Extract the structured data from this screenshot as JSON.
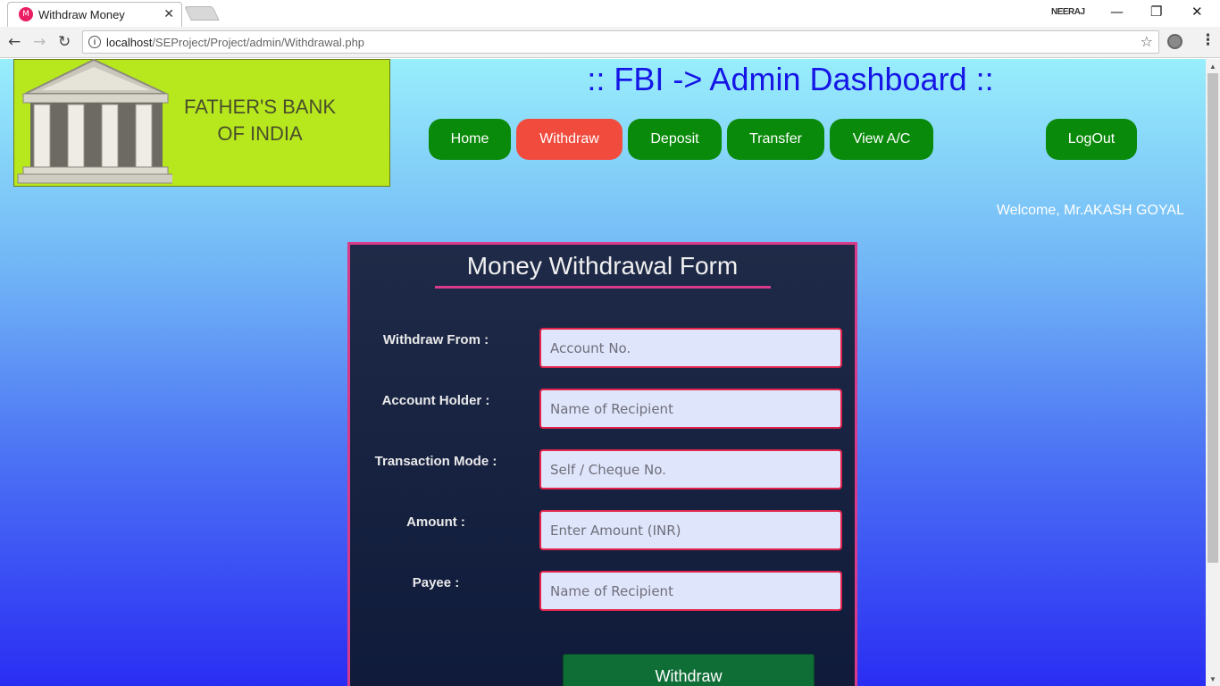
{
  "browser": {
    "tab_title": "Withdraw Money",
    "tab_close": "✕",
    "user": "NEERAJ",
    "url_host": "localhost",
    "url_path": "/SEProject/Project/admin/Withdrawal.php",
    "win_minimize": "—",
    "win_restore": "❐",
    "win_close": "✕",
    "back": "←",
    "forward": "→",
    "reload": "↻",
    "star": "☆",
    "menu": "⋮",
    "info": "i"
  },
  "logo": {
    "line1": "FATHER'S BANK",
    "line2": "OF INDIA"
  },
  "header": {
    "title": ":: FBI -> Admin Dashboard ::"
  },
  "nav": {
    "home": "Home",
    "withdraw": "Withdraw",
    "deposit": "Deposit",
    "transfer": "Transfer",
    "view_ac": "View A/C",
    "logout": "LogOut",
    "active_color": "#f14b3e",
    "button_color": "#0a8a0a"
  },
  "welcome": "Welcome, Mr.AKASH GOYAL",
  "form": {
    "title": "Money Withdrawal Form",
    "fields": [
      {
        "label": "Withdraw From :",
        "placeholder": "Account No."
      },
      {
        "label": "Account Holder :",
        "placeholder": "Name of Recipient"
      },
      {
        "label": "Transaction Mode :",
        "placeholder": "Self / Cheque No."
      },
      {
        "label": "Amount :",
        "placeholder": "Enter Amount (INR)"
      },
      {
        "label": "Payee :",
        "placeholder": "Name of Recipient"
      }
    ],
    "submit": "Withdraw"
  }
}
